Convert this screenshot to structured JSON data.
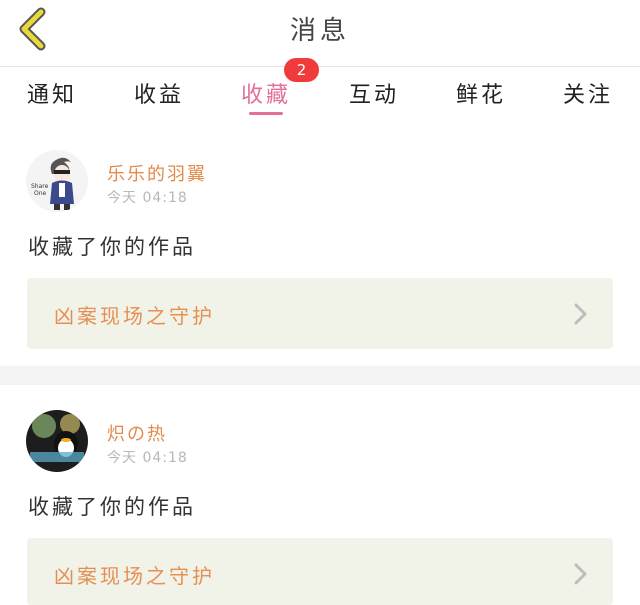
{
  "header": {
    "title": "消息"
  },
  "tabs": [
    {
      "label": "通知"
    },
    {
      "label": "收益"
    },
    {
      "label": "收藏",
      "badge": "2"
    },
    {
      "label": "互动"
    },
    {
      "label": "鲜花"
    },
    {
      "label": "关注"
    }
  ],
  "notifications": [
    {
      "username": "乐乐的羽翼",
      "time": "今天 04:18",
      "message": "收藏了你的作品",
      "work_title": "凶案现场之守护"
    },
    {
      "username": "炽の热",
      "time": "今天 04:18",
      "message": "收藏了你的作品",
      "work_title": "凶案现场之守护"
    }
  ],
  "colors": {
    "accent": "#e46f9c",
    "badge": "#ef3b3b",
    "name": "#e38b4a",
    "card_bg": "#f1f3e9",
    "back_icon": "#e8d83a"
  }
}
